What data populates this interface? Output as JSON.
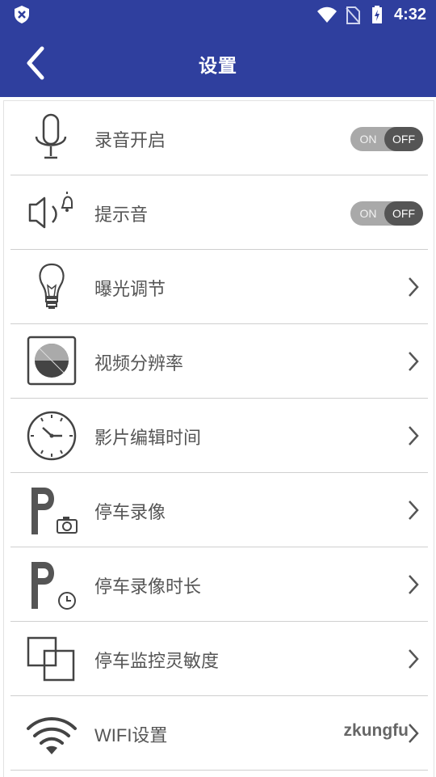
{
  "status_bar": {
    "time": "4:32"
  },
  "app_bar": {
    "title": "设置"
  },
  "settings": [
    {
      "label": "录音开启",
      "control": "toggle",
      "on": "ON",
      "off": "OFF"
    },
    {
      "label": "提示音",
      "control": "toggle",
      "on": "ON",
      "off": "OFF"
    },
    {
      "label": "曝光调节",
      "control": "chevron"
    },
    {
      "label": "视频分辨率",
      "control": "chevron"
    },
    {
      "label": "影片编辑时间",
      "control": "chevron"
    },
    {
      "label": "停车录像",
      "control": "chevron"
    },
    {
      "label": "停车录像时长",
      "control": "chevron"
    },
    {
      "label": "停车监控灵敏度",
      "control": "chevron"
    },
    {
      "label": "WIFI设置",
      "control": "value",
      "value": "zkungfu"
    }
  ],
  "colors": {
    "primary": "#2f3f9e",
    "toggle_off": "#555555",
    "toggle_bg": "#a9a9a9"
  }
}
